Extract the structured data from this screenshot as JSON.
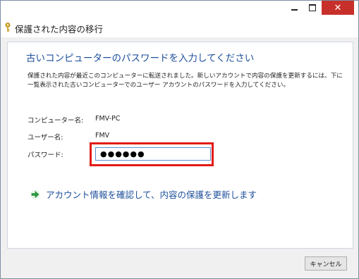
{
  "window": {
    "title": "保護された内容の移行",
    "controls": {
      "minimize": "minimize",
      "maximize": "maximize",
      "close": "✕"
    }
  },
  "main": {
    "heading": "古いコンピューターのパスワードを入力してください",
    "description": "保護された内容が最近このコンピューターに転送されました。新しいアカウントで内容の保護を更新するには、下に一覧表示された古いコンピューターでのユーザー アカウントのパスワードを入力してください。",
    "fields": {
      "computer_name_label": "コンピューター名:",
      "computer_name_value": "FMV-PC",
      "user_name_label": "ユーザー名:",
      "user_name_value": "FMV",
      "password_label": "パスワード:",
      "password_value": "●●●●●●"
    },
    "action_link": "アカウント情報を確認して、内容の保護を更新します"
  },
  "footer": {
    "cancel_label": "キャンセル"
  },
  "colors": {
    "heading": "#1d4f9b",
    "highlight": "#e31b17",
    "close_button": "#c7302a",
    "arrow_icon": "#2e9e3f"
  },
  "icons": {
    "title_icon": "key-icon",
    "action_icon": "green-arrow-icon"
  }
}
